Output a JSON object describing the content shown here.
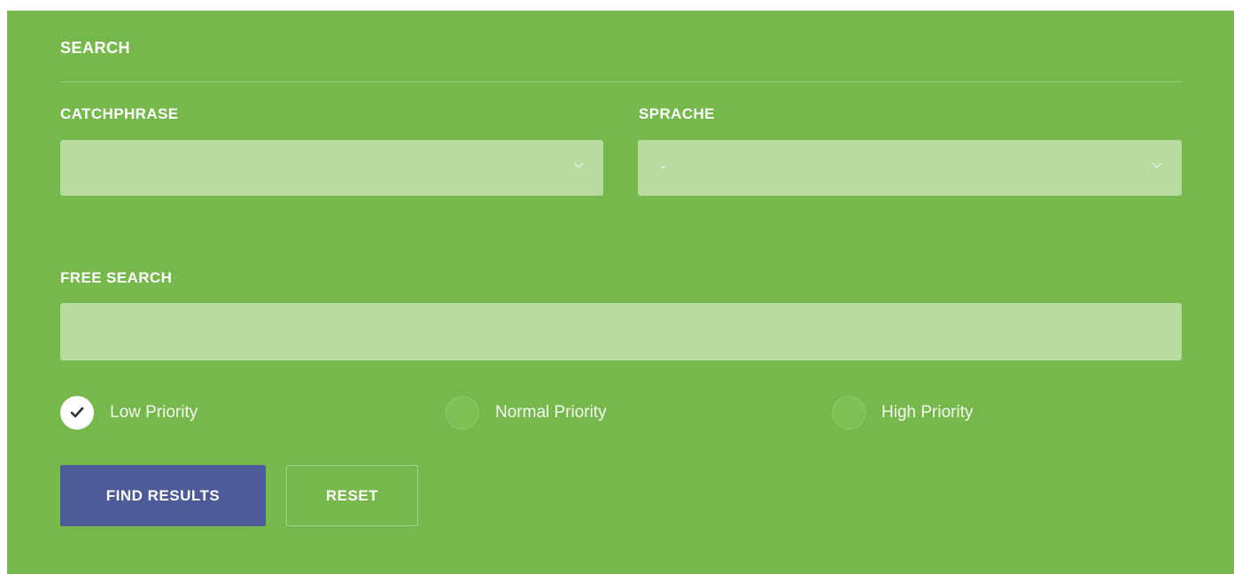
{
  "search": {
    "title": "SEARCH",
    "catchphrase": {
      "label": "CATCHPHRASE",
      "value": "",
      "icon": "chevron-down-icon"
    },
    "sprache": {
      "label": "SPRACHE",
      "value": "-",
      "icon": "chevron-down-icon"
    },
    "free_search": {
      "label": "FREE SEARCH",
      "value": "",
      "placeholder": ""
    },
    "priorities": [
      {
        "label": "Low Priority",
        "checked": true
      },
      {
        "label": "Normal Priority",
        "checked": false
      },
      {
        "label": "High Priority",
        "checked": false
      }
    ],
    "buttons": {
      "find": "FIND RESULTS",
      "reset": "RESET"
    }
  },
  "colors": {
    "panel_bg": "#77b84c",
    "input_bg": "#b7dba1",
    "primary_button": "#4e5b99",
    "text": "#ffffff"
  }
}
